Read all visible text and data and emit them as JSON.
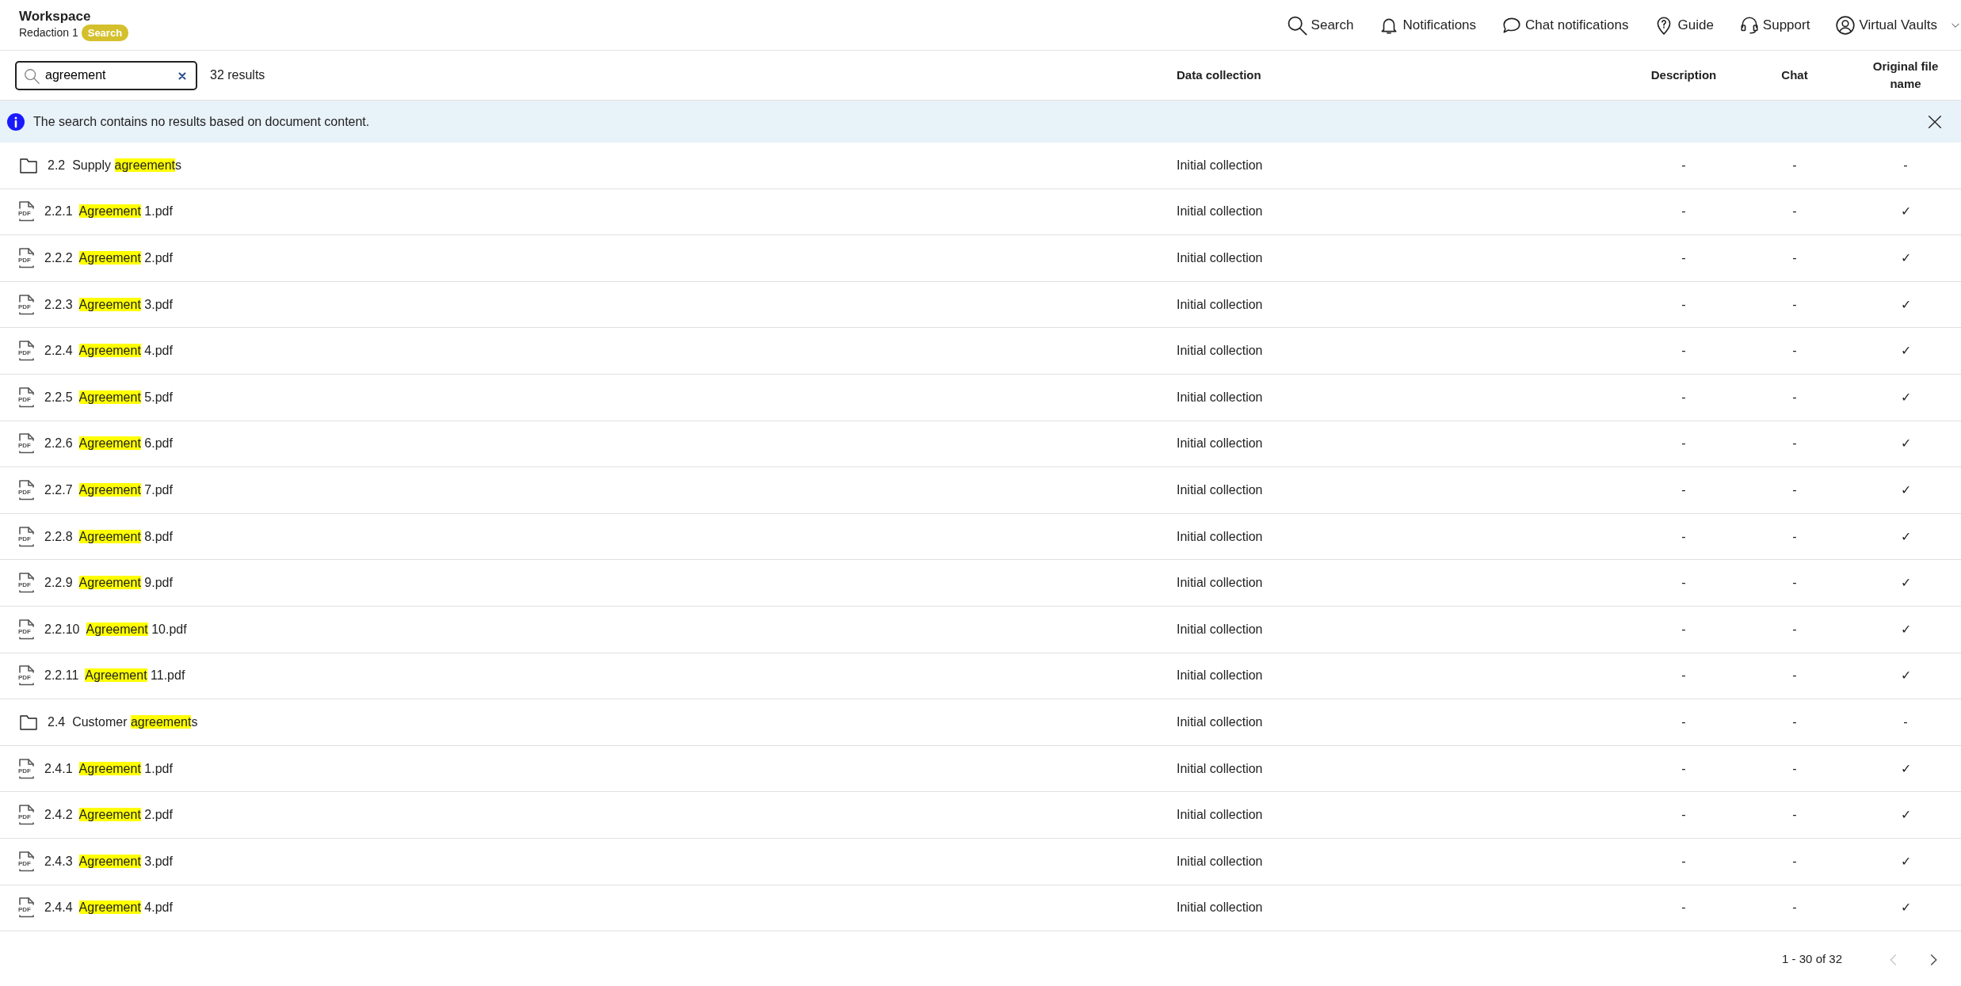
{
  "header": {
    "title": "Workspace",
    "subtitle": "Redaction 1",
    "badge": "Search"
  },
  "nav": [
    {
      "kind": "search",
      "label": "Search"
    },
    {
      "kind": "bell",
      "label": "Notifications"
    },
    {
      "kind": "chat",
      "label": "Chat notifications"
    },
    {
      "kind": "guide",
      "label": "Guide"
    },
    {
      "kind": "support",
      "label": "Support"
    },
    {
      "kind": "user",
      "label": "Virtual Vaults"
    }
  ],
  "search": {
    "value": "agreement",
    "count": "32 results"
  },
  "columns": [
    "Data collection",
    "Description",
    "Chat",
    "Original file name"
  ],
  "info": "The search contains no results based on document content.",
  "rows": [
    {
      "kind": "folder",
      "number": "2.2",
      "before": "Supply ",
      "match": "agreement",
      "after": "s",
      "collection": "Initial collection",
      "description": "-",
      "chat": "-",
      "original": "-"
    },
    {
      "kind": "pdf",
      "icon_label": "PDF",
      "number": "2.2.1",
      "before": "",
      "match": "Agreement",
      "after": " 1.pdf",
      "collection": "Initial collection",
      "description": "-",
      "chat": "-",
      "original": "✓"
    },
    {
      "kind": "pdf",
      "icon_label": "PDF",
      "number": "2.2.2",
      "before": "",
      "match": "Agreement",
      "after": " 2.pdf",
      "collection": "Initial collection",
      "description": "-",
      "chat": "-",
      "original": "✓"
    },
    {
      "kind": "pdf",
      "icon_label": "PDF",
      "number": "2.2.3",
      "before": "",
      "match": "Agreement",
      "after": " 3.pdf",
      "collection": "Initial collection",
      "description": "-",
      "chat": "-",
      "original": "✓"
    },
    {
      "kind": "pdf",
      "icon_label": "PDF",
      "number": "2.2.4",
      "before": "",
      "match": "Agreement",
      "after": " 4.pdf",
      "collection": "Initial collection",
      "description": "-",
      "chat": "-",
      "original": "✓"
    },
    {
      "kind": "pdf",
      "icon_label": "PDF",
      "number": "2.2.5",
      "before": "",
      "match": "Agreement",
      "after": " 5.pdf",
      "collection": "Initial collection",
      "description": "-",
      "chat": "-",
      "original": "✓"
    },
    {
      "kind": "pdf",
      "icon_label": "PDF",
      "number": "2.2.6",
      "before": "",
      "match": "Agreement",
      "after": " 6.pdf",
      "collection": "Initial collection",
      "description": "-",
      "chat": "-",
      "original": "✓"
    },
    {
      "kind": "pdf",
      "icon_label": "PDF",
      "number": "2.2.7",
      "before": "",
      "match": "Agreement",
      "after": " 7.pdf",
      "collection": "Initial collection",
      "description": "-",
      "chat": "-",
      "original": "✓"
    },
    {
      "kind": "pdf",
      "icon_label": "PDF",
      "number": "2.2.8",
      "before": "",
      "match": "Agreement",
      "after": " 8.pdf",
      "collection": "Initial collection",
      "description": "-",
      "chat": "-",
      "original": "✓"
    },
    {
      "kind": "pdf",
      "icon_label": "PDF",
      "number": "2.2.9",
      "before": "",
      "match": "Agreement",
      "after": " 9.pdf",
      "collection": "Initial collection",
      "description": "-",
      "chat": "-",
      "original": "✓"
    },
    {
      "kind": "pdf",
      "icon_label": "PDF",
      "number": "2.2.10",
      "before": "",
      "match": "Agreement",
      "after": " 10.pdf",
      "collection": "Initial collection",
      "description": "-",
      "chat": "-",
      "original": "✓"
    },
    {
      "kind": "pdf",
      "icon_label": "PDF",
      "number": "2.2.11",
      "before": "",
      "match": "Agreement",
      "after": " 11.pdf",
      "collection": "Initial collection",
      "description": "-",
      "chat": "-",
      "original": "✓"
    },
    {
      "kind": "folder",
      "number": "2.4",
      "before": "Customer ",
      "match": "agreement",
      "after": "s",
      "collection": "Initial collection",
      "description": "-",
      "chat": "-",
      "original": "-"
    },
    {
      "kind": "pdf",
      "icon_label": "PDF",
      "number": "2.4.1",
      "before": "",
      "match": "Agreement",
      "after": " 1.pdf",
      "collection": "Initial collection",
      "description": "-",
      "chat": "-",
      "original": "✓"
    },
    {
      "kind": "pdf",
      "icon_label": "PDF",
      "number": "2.4.2",
      "before": "",
      "match": "Agreement",
      "after": " 2.pdf",
      "collection": "Initial collection",
      "description": "-",
      "chat": "-",
      "original": "✓"
    },
    {
      "kind": "pdf",
      "icon_label": "PDF",
      "number": "2.4.3",
      "before": "",
      "match": "Agreement",
      "after": " 3.pdf",
      "collection": "Initial collection",
      "description": "-",
      "chat": "-",
      "original": "✓"
    },
    {
      "kind": "pdf",
      "icon_label": "PDF",
      "number": "2.4.4",
      "before": "",
      "match": "Agreement",
      "after": " 4.pdf",
      "collection": "Initial collection",
      "description": "-",
      "chat": "-",
      "original": "✓"
    }
  ],
  "pager": {
    "range": "1 - 30 of 32",
    "prev_disabled": true,
    "next_disabled": false
  }
}
